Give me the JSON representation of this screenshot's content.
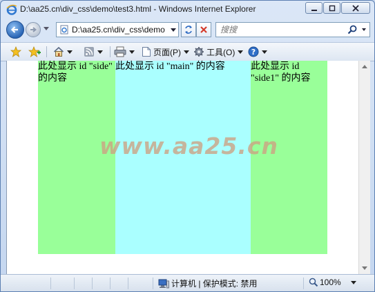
{
  "window": {
    "title": "D:\\aa25.cn\\div_css\\demo\\test3.html - Windows Internet Explorer"
  },
  "address_bar": {
    "url": "D:\\aa25.cn\\div_css\\demo"
  },
  "search": {
    "placeholder": "搜搜"
  },
  "command_bar": {
    "page_label": "页面(P)",
    "tools_label": "工具(O)"
  },
  "page": {
    "side_text": "此处显示 id \"side\" 的内容",
    "main_text": "此处显示 id \"main\" 的内容",
    "side1_text": "此处显示 id \"side1\" 的内容",
    "watermark": "www.aa25.cn"
  },
  "status_bar": {
    "zone": "计算机 | 保护模式: 禁用",
    "zoom": "100%"
  },
  "colors": {
    "side_bg": "#99ff99",
    "main_bg": "#aaffff"
  }
}
